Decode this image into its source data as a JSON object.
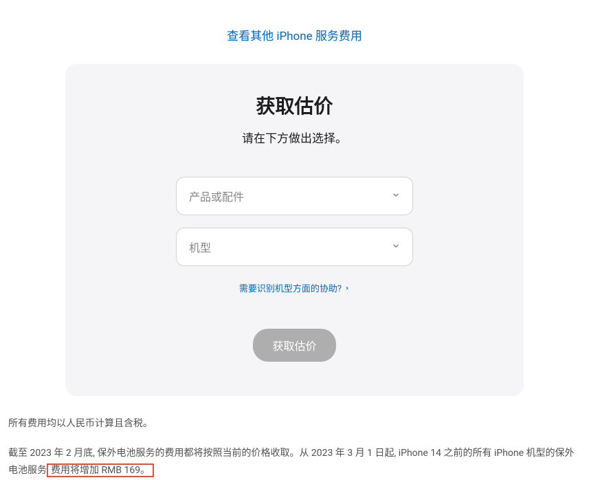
{
  "topLink": {
    "label": "查看其他 iPhone 服务费用"
  },
  "card": {
    "title": "获取估价",
    "subtitle": "请在下方做出选择。",
    "select1": {
      "placeholder": "产品或配件"
    },
    "select2": {
      "placeholder": "机型"
    },
    "helpLink": {
      "label": "需要识别机型方面的协助?"
    },
    "submit": {
      "label": "获取估价"
    }
  },
  "footer": {
    "line1": "所有费用均以人民币计算且含税。",
    "line2_part1": "截至 2023 年 2 月底, 保外电池服务的费用都将按照当前的价格收取。从 2023 年 3 月 1 日起, iPhone 14 之前的所有 iPhone 机型的保外电池服务",
    "line2_highlight": "费用将增加 RMB 169。"
  }
}
